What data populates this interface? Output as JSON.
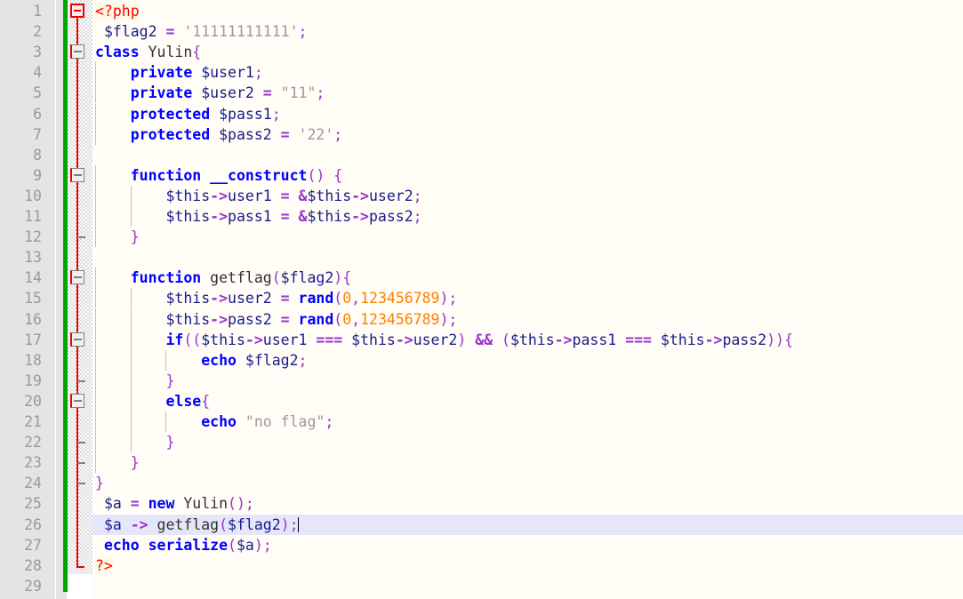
{
  "app": {
    "name": "text-editor",
    "language": "PHP",
    "total_lines": 29,
    "current_line": 26
  },
  "colors": {
    "editor_background": "#fffdf5",
    "line_number_margin": "#e4e4e4",
    "line_number_text": "#9a9a9a",
    "change_bar": "#00a600",
    "fold_line": "#ee0000",
    "fold_box_border": "#808080",
    "current_line_highlight": "#e6e6fa",
    "keyword": "#0000ff",
    "variable": "#1a1a8c",
    "operator": "#9933cc",
    "string": "#9a9a9a",
    "number": "#ff8000",
    "php_tag": "#ff0000",
    "php_tag_background": "#fffbe6",
    "plain_text": "#303030",
    "indent_guide": "#b8b8b8"
  },
  "gutter": {
    "line_numbers": [
      "1",
      "2",
      "3",
      "4",
      "5",
      "6",
      "7",
      "8",
      "9",
      "10",
      "11",
      "12",
      "13",
      "14",
      "15",
      "16",
      "17",
      "18",
      "19",
      "20",
      "21",
      "22",
      "23",
      "24",
      "25",
      "26",
      "27",
      "28",
      "29"
    ]
  },
  "code": {
    "lines": [
      {
        "n": 1,
        "tokens": [
          {
            "t": "<?php",
            "c": "t-tag"
          }
        ]
      },
      {
        "n": 2,
        "tokens": [
          {
            "t": " ",
            "c": "t-plain"
          },
          {
            "t": "$flag2",
            "c": "t-var"
          },
          {
            "t": " ",
            "c": "t-plain"
          },
          {
            "t": "=",
            "c": "t-op"
          },
          {
            "t": " ",
            "c": "t-plain"
          },
          {
            "t": "'11111111111'",
            "c": "t-str"
          },
          {
            "t": ";",
            "c": "t-punct"
          }
        ]
      },
      {
        "n": 3,
        "tokens": [
          {
            "t": "class",
            "c": "t-kw"
          },
          {
            "t": " Yulin",
            "c": "t-ident"
          },
          {
            "t": "{",
            "c": "t-brace"
          }
        ]
      },
      {
        "n": 4,
        "tokens": [
          {
            "t": "    ",
            "c": "t-plain"
          },
          {
            "t": "private",
            "c": "t-kw"
          },
          {
            "t": " ",
            "c": "t-plain"
          },
          {
            "t": "$user1",
            "c": "t-var"
          },
          {
            "t": ";",
            "c": "t-punct"
          }
        ]
      },
      {
        "n": 5,
        "tokens": [
          {
            "t": "    ",
            "c": "t-plain"
          },
          {
            "t": "private",
            "c": "t-kw"
          },
          {
            "t": " ",
            "c": "t-plain"
          },
          {
            "t": "$user2",
            "c": "t-var"
          },
          {
            "t": " ",
            "c": "t-plain"
          },
          {
            "t": "=",
            "c": "t-op"
          },
          {
            "t": " ",
            "c": "t-plain"
          },
          {
            "t": "\"11\"",
            "c": "t-str"
          },
          {
            "t": ";",
            "c": "t-punct"
          }
        ]
      },
      {
        "n": 6,
        "tokens": [
          {
            "t": "    ",
            "c": "t-plain"
          },
          {
            "t": "protected",
            "c": "t-kw"
          },
          {
            "t": " ",
            "c": "t-plain"
          },
          {
            "t": "$pass1",
            "c": "t-var"
          },
          {
            "t": ";",
            "c": "t-punct"
          }
        ]
      },
      {
        "n": 7,
        "tokens": [
          {
            "t": "    ",
            "c": "t-plain"
          },
          {
            "t": "protected",
            "c": "t-kw"
          },
          {
            "t": " ",
            "c": "t-plain"
          },
          {
            "t": "$pass2",
            "c": "t-var"
          },
          {
            "t": " ",
            "c": "t-plain"
          },
          {
            "t": "=",
            "c": "t-op"
          },
          {
            "t": " ",
            "c": "t-plain"
          },
          {
            "t": "'22'",
            "c": "t-str"
          },
          {
            "t": ";",
            "c": "t-punct"
          }
        ]
      },
      {
        "n": 8,
        "tokens": []
      },
      {
        "n": 9,
        "tokens": [
          {
            "t": "    ",
            "c": "t-plain"
          },
          {
            "t": "function",
            "c": "t-kw"
          },
          {
            "t": " ",
            "c": "t-plain"
          },
          {
            "t": "__construct",
            "c": "t-kw"
          },
          {
            "t": "()",
            "c": "t-punct"
          },
          {
            "t": " ",
            "c": "t-plain"
          },
          {
            "t": "{",
            "c": "t-brace"
          }
        ]
      },
      {
        "n": 10,
        "tokens": [
          {
            "t": "        ",
            "c": "t-plain"
          },
          {
            "t": "$this",
            "c": "t-var"
          },
          {
            "t": "->",
            "c": "t-op"
          },
          {
            "t": "user1",
            "c": "t-var"
          },
          {
            "t": " ",
            "c": "t-plain"
          },
          {
            "t": "=",
            "c": "t-op"
          },
          {
            "t": " ",
            "c": "t-plain"
          },
          {
            "t": "&",
            "c": "t-op"
          },
          {
            "t": "$this",
            "c": "t-var"
          },
          {
            "t": "->",
            "c": "t-op"
          },
          {
            "t": "user2",
            "c": "t-var"
          },
          {
            "t": ";",
            "c": "t-punct"
          }
        ]
      },
      {
        "n": 11,
        "tokens": [
          {
            "t": "        ",
            "c": "t-plain"
          },
          {
            "t": "$this",
            "c": "t-var"
          },
          {
            "t": "->",
            "c": "t-op"
          },
          {
            "t": "pass1",
            "c": "t-var"
          },
          {
            "t": " ",
            "c": "t-plain"
          },
          {
            "t": "=",
            "c": "t-op"
          },
          {
            "t": " ",
            "c": "t-plain"
          },
          {
            "t": "&",
            "c": "t-op"
          },
          {
            "t": "$this",
            "c": "t-var"
          },
          {
            "t": "->",
            "c": "t-op"
          },
          {
            "t": "pass2",
            "c": "t-var"
          },
          {
            "t": ";",
            "c": "t-punct"
          }
        ]
      },
      {
        "n": 12,
        "tokens": [
          {
            "t": "    ",
            "c": "t-plain"
          },
          {
            "t": "}",
            "c": "t-brace"
          }
        ]
      },
      {
        "n": 13,
        "tokens": []
      },
      {
        "n": 14,
        "tokens": [
          {
            "t": "    ",
            "c": "t-plain"
          },
          {
            "t": "function",
            "c": "t-kw"
          },
          {
            "t": " getflag",
            "c": "t-ident"
          },
          {
            "t": "(",
            "c": "t-punct"
          },
          {
            "t": "$flag2",
            "c": "t-var"
          },
          {
            "t": ")",
            "c": "t-punct"
          },
          {
            "t": "{",
            "c": "t-brace"
          }
        ]
      },
      {
        "n": 15,
        "tokens": [
          {
            "t": "        ",
            "c": "t-plain"
          },
          {
            "t": "$this",
            "c": "t-var"
          },
          {
            "t": "->",
            "c": "t-op"
          },
          {
            "t": "user2",
            "c": "t-var"
          },
          {
            "t": " ",
            "c": "t-plain"
          },
          {
            "t": "=",
            "c": "t-op"
          },
          {
            "t": " ",
            "c": "t-plain"
          },
          {
            "t": "rand",
            "c": "t-kw"
          },
          {
            "t": "(",
            "c": "t-punct"
          },
          {
            "t": "0",
            "c": "t-num"
          },
          {
            "t": ",",
            "c": "t-punct"
          },
          {
            "t": "123456789",
            "c": "t-num"
          },
          {
            "t": ")",
            "c": "t-punct"
          },
          {
            "t": ";",
            "c": "t-punct"
          }
        ]
      },
      {
        "n": 16,
        "tokens": [
          {
            "t": "        ",
            "c": "t-plain"
          },
          {
            "t": "$this",
            "c": "t-var"
          },
          {
            "t": "->",
            "c": "t-op"
          },
          {
            "t": "pass2",
            "c": "t-var"
          },
          {
            "t": " ",
            "c": "t-plain"
          },
          {
            "t": "=",
            "c": "t-op"
          },
          {
            "t": " ",
            "c": "t-plain"
          },
          {
            "t": "rand",
            "c": "t-kw"
          },
          {
            "t": "(",
            "c": "t-punct"
          },
          {
            "t": "0",
            "c": "t-num"
          },
          {
            "t": ",",
            "c": "t-punct"
          },
          {
            "t": "123456789",
            "c": "t-num"
          },
          {
            "t": ")",
            "c": "t-punct"
          },
          {
            "t": ";",
            "c": "t-punct"
          }
        ]
      },
      {
        "n": 17,
        "tokens": [
          {
            "t": "        ",
            "c": "t-plain"
          },
          {
            "t": "if",
            "c": "t-kw"
          },
          {
            "t": "((",
            "c": "t-punct"
          },
          {
            "t": "$this",
            "c": "t-var"
          },
          {
            "t": "->",
            "c": "t-op"
          },
          {
            "t": "user1",
            "c": "t-var"
          },
          {
            "t": " ",
            "c": "t-plain"
          },
          {
            "t": "===",
            "c": "t-op"
          },
          {
            "t": " ",
            "c": "t-plain"
          },
          {
            "t": "$this",
            "c": "t-var"
          },
          {
            "t": "->",
            "c": "t-op"
          },
          {
            "t": "user2",
            "c": "t-var"
          },
          {
            "t": ")",
            "c": "t-punct"
          },
          {
            "t": " ",
            "c": "t-plain"
          },
          {
            "t": "&&",
            "c": "t-op"
          },
          {
            "t": " ",
            "c": "t-plain"
          },
          {
            "t": "(",
            "c": "t-punct"
          },
          {
            "t": "$this",
            "c": "t-var"
          },
          {
            "t": "->",
            "c": "t-op"
          },
          {
            "t": "pass1",
            "c": "t-var"
          },
          {
            "t": " ",
            "c": "t-plain"
          },
          {
            "t": "===",
            "c": "t-op"
          },
          {
            "t": " ",
            "c": "t-plain"
          },
          {
            "t": "$this",
            "c": "t-var"
          },
          {
            "t": "->",
            "c": "t-op"
          },
          {
            "t": "pass2",
            "c": "t-var"
          },
          {
            "t": "))",
            "c": "t-punct"
          },
          {
            "t": "{",
            "c": "t-brace"
          }
        ]
      },
      {
        "n": 18,
        "tokens": [
          {
            "t": "            ",
            "c": "t-plain"
          },
          {
            "t": "echo",
            "c": "t-kw"
          },
          {
            "t": " ",
            "c": "t-plain"
          },
          {
            "t": "$flag2",
            "c": "t-var"
          },
          {
            "t": ";",
            "c": "t-punct"
          }
        ]
      },
      {
        "n": 19,
        "tokens": [
          {
            "t": "        ",
            "c": "t-plain"
          },
          {
            "t": "}",
            "c": "t-brace"
          }
        ]
      },
      {
        "n": 20,
        "tokens": [
          {
            "t": "        ",
            "c": "t-plain"
          },
          {
            "t": "else",
            "c": "t-kw"
          },
          {
            "t": "{",
            "c": "t-brace"
          }
        ]
      },
      {
        "n": 21,
        "tokens": [
          {
            "t": "            ",
            "c": "t-plain"
          },
          {
            "t": "echo",
            "c": "t-kw"
          },
          {
            "t": " ",
            "c": "t-plain"
          },
          {
            "t": "\"no flag\"",
            "c": "t-str"
          },
          {
            "t": ";",
            "c": "t-punct"
          }
        ]
      },
      {
        "n": 22,
        "tokens": [
          {
            "t": "        ",
            "c": "t-plain"
          },
          {
            "t": "}",
            "c": "t-brace"
          }
        ]
      },
      {
        "n": 23,
        "tokens": [
          {
            "t": "    ",
            "c": "t-plain"
          },
          {
            "t": "}",
            "c": "t-brace"
          }
        ]
      },
      {
        "n": 24,
        "tokens": [
          {
            "t": "}",
            "c": "t-brace"
          }
        ]
      },
      {
        "n": 25,
        "tokens": [
          {
            "t": " ",
            "c": "t-plain"
          },
          {
            "t": "$a",
            "c": "t-var"
          },
          {
            "t": " ",
            "c": "t-plain"
          },
          {
            "t": "=",
            "c": "t-op"
          },
          {
            "t": " ",
            "c": "t-plain"
          },
          {
            "t": "new",
            "c": "t-kw"
          },
          {
            "t": " Yulin",
            "c": "t-ident"
          },
          {
            "t": "()",
            "c": "t-punct"
          },
          {
            "t": ";",
            "c": "t-punct"
          }
        ]
      },
      {
        "n": 26,
        "tokens": [
          {
            "t": " ",
            "c": "t-plain"
          },
          {
            "t": "$a",
            "c": "t-var"
          },
          {
            "t": " ",
            "c": "t-plain"
          },
          {
            "t": "->",
            "c": "t-op"
          },
          {
            "t": " getflag",
            "c": "t-ident"
          },
          {
            "t": "(",
            "c": "t-punct"
          },
          {
            "t": "$flag2",
            "c": "t-var"
          },
          {
            "t": ")",
            "c": "t-punct"
          },
          {
            "t": ";",
            "c": "t-punct"
          }
        ],
        "caret": true,
        "current": true
      },
      {
        "n": 27,
        "tokens": [
          {
            "t": " ",
            "c": "t-plain"
          },
          {
            "t": "echo",
            "c": "t-kw"
          },
          {
            "t": " ",
            "c": "t-plain"
          },
          {
            "t": "serialize",
            "c": "t-kw"
          },
          {
            "t": "(",
            "c": "t-punct"
          },
          {
            "t": "$a",
            "c": "t-var"
          },
          {
            "t": ")",
            "c": "t-punct"
          },
          {
            "t": ";",
            "c": "t-punct"
          }
        ]
      },
      {
        "n": 28,
        "tokens": [
          {
            "t": "?>",
            "c": "t-tag"
          }
        ]
      },
      {
        "n": 29,
        "tokens": []
      }
    ]
  },
  "folds": [
    {
      "line": 1,
      "type": "box-root",
      "label": "fold-marker-php-open"
    },
    {
      "line": 3,
      "type": "box",
      "label": "fold-marker-class-yulin"
    },
    {
      "line": 9,
      "type": "box",
      "label": "fold-marker-construct"
    },
    {
      "line": 12,
      "type": "tick",
      "label": "fold-end-construct"
    },
    {
      "line": 14,
      "type": "box",
      "label": "fold-marker-getflag"
    },
    {
      "line": 17,
      "type": "box",
      "label": "fold-marker-if"
    },
    {
      "line": 19,
      "type": "tick",
      "label": "fold-end-if"
    },
    {
      "line": 20,
      "type": "box",
      "label": "fold-marker-else"
    },
    {
      "line": 22,
      "type": "tick",
      "label": "fold-end-else"
    },
    {
      "line": 23,
      "type": "tick",
      "label": "fold-end-getflag"
    },
    {
      "line": 24,
      "type": "tick",
      "label": "fold-end-class"
    },
    {
      "line": 28,
      "type": "end",
      "label": "fold-end-php"
    }
  ]
}
